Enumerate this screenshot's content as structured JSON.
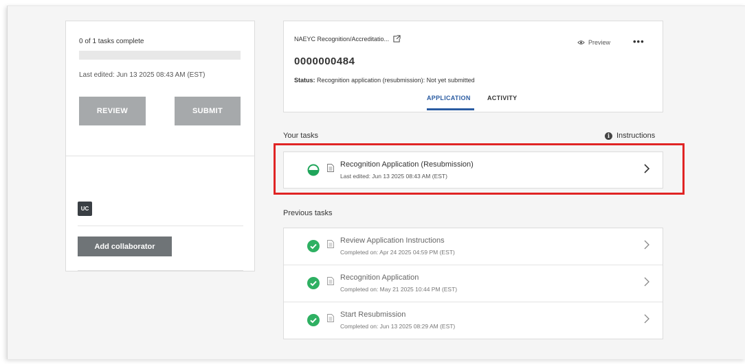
{
  "progress": {
    "text": "0 of 1 tasks complete",
    "fraction": 0,
    "last_edited": "Last edited: Jun 13 2025 08:43 AM (EST)"
  },
  "actions": {
    "review_label": "REVIEW",
    "submit_label": "SUBMIT"
  },
  "collaborators": {
    "initials": "UC",
    "add_label": "Add collaborator"
  },
  "header": {
    "org_name": "NAEYC Recognition/Accreditatio...",
    "preview_label": "Preview",
    "more_label": "•••",
    "application_id": "0000000484",
    "status_label": "Status:",
    "status_value": "Recognition application (resubmission): Not yet submitted",
    "tabs": [
      {
        "label": "APPLICATION",
        "active": true
      },
      {
        "label": "ACTIVITY",
        "active": false
      }
    ]
  },
  "your_tasks": {
    "heading": "Your tasks",
    "instructions_label": "Instructions",
    "items": [
      {
        "title": "Recognition Application (Resubmission)",
        "subtitle": "Last edited: Jun 13 2025 08:43 AM (EST)",
        "status_icon": "half-circle-icon"
      }
    ]
  },
  "previous_tasks": {
    "heading": "Previous tasks",
    "items": [
      {
        "title": "Review Application Instructions",
        "subtitle": "Completed on: Apr 24 2025 04:59 PM (EST)",
        "status_icon": "check-circle-icon"
      },
      {
        "title": "Recognition Application",
        "subtitle": "Completed on: May 21 2025 10:44 PM (EST)",
        "status_icon": "check-circle-icon"
      },
      {
        "title": "Start Resubmission",
        "subtitle": "Completed on: Jun 13 2025 08:29 AM (EST)",
        "status_icon": "check-circle-icon"
      }
    ]
  },
  "colors": {
    "accent_blue": "#2a5ba1",
    "success_green": "#27ae60",
    "highlight_red": "#e02424",
    "button_gray": "#a6a9ab"
  }
}
